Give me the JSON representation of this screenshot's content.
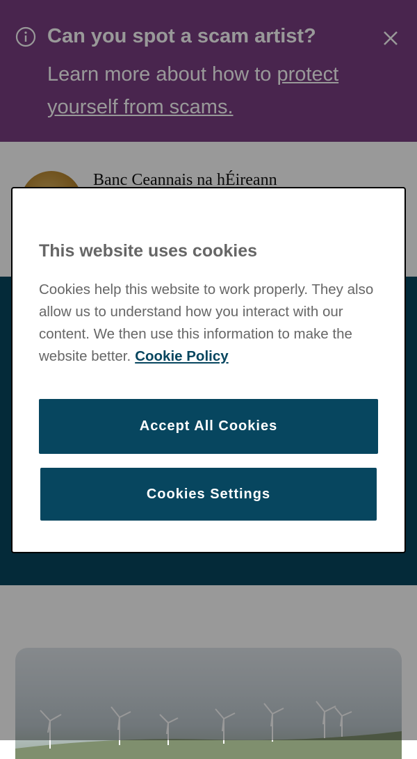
{
  "banner": {
    "title": "Can you spot a scam artist?",
    "body_prefix": "Learn more about how to ",
    "link_text": "protect yourself from scams.",
    "icons": {
      "info": "info-circle-icon",
      "close": "close-icon"
    },
    "background_color": "#7a3f82"
  },
  "header": {
    "org_name": "Banc Ceannais na hÉireann",
    "logo": "harp-seal-logo"
  },
  "cookie_modal": {
    "heading": "This website uses cookies",
    "description": "Cookies help this website to work properly. They also allow us to understand how you interact with our content. We then use this information to make the website better.",
    "policy_link": "Cookie Policy",
    "accept_label": "Accept All Cookies",
    "settings_label": "Cookies Settings",
    "button_color": "#07465f"
  },
  "colors": {
    "hero": "#07465f",
    "overlay": "rgba(0,0,0,0.40)"
  }
}
